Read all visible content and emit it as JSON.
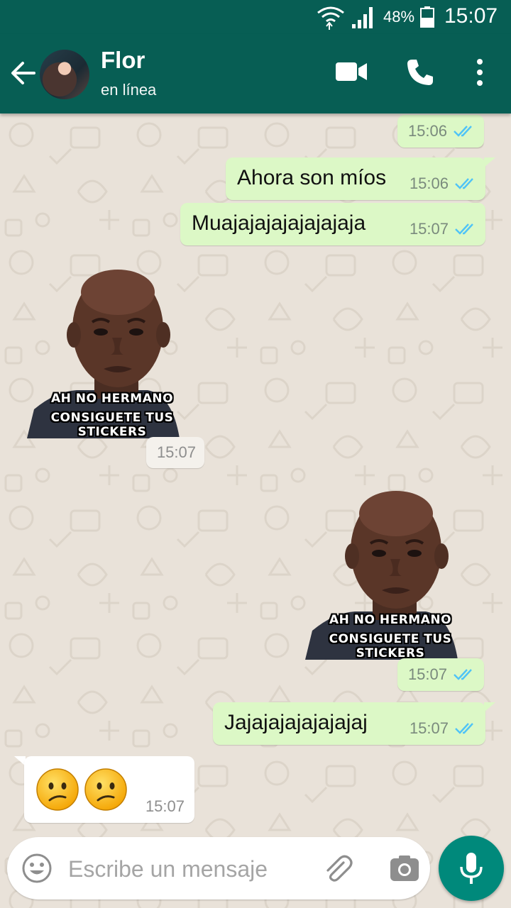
{
  "status_bar": {
    "battery": "48%",
    "time": "15:07"
  },
  "chat_header": {
    "contact_name": "Flor",
    "status": "en línea"
  },
  "messages": [
    {
      "type": "out_meta",
      "time": "15:06"
    },
    {
      "type": "out_text",
      "text": "Ahora son míos",
      "time": "15:06"
    },
    {
      "type": "out_text",
      "text": "Muajajajajajajajaja",
      "time": "15:07"
    },
    {
      "type": "in_sticker",
      "caption_line1": "AH NO HERMANO",
      "caption_line2": "CONSIGUETE TUS STICKERS",
      "time": "15:07"
    },
    {
      "type": "out_sticker",
      "caption_line1": "AH NO HERMANO",
      "caption_line2": "CONSIGUETE TUS STICKERS",
      "time": "15:07"
    },
    {
      "type": "out_text",
      "text": "Jajajajajajajajaj",
      "time": "15:07"
    },
    {
      "type": "in_emoji",
      "emoji": "confused-face x2",
      "time": "15:07"
    }
  ],
  "composer": {
    "placeholder": "Escribe un mensaje"
  },
  "colors": {
    "header": "#075e54",
    "outgoing_bubble": "#dcf8c6",
    "incoming_bubble": "#ffffff",
    "read_ticks": "#4fc3f7",
    "mic_button": "#00897b"
  }
}
